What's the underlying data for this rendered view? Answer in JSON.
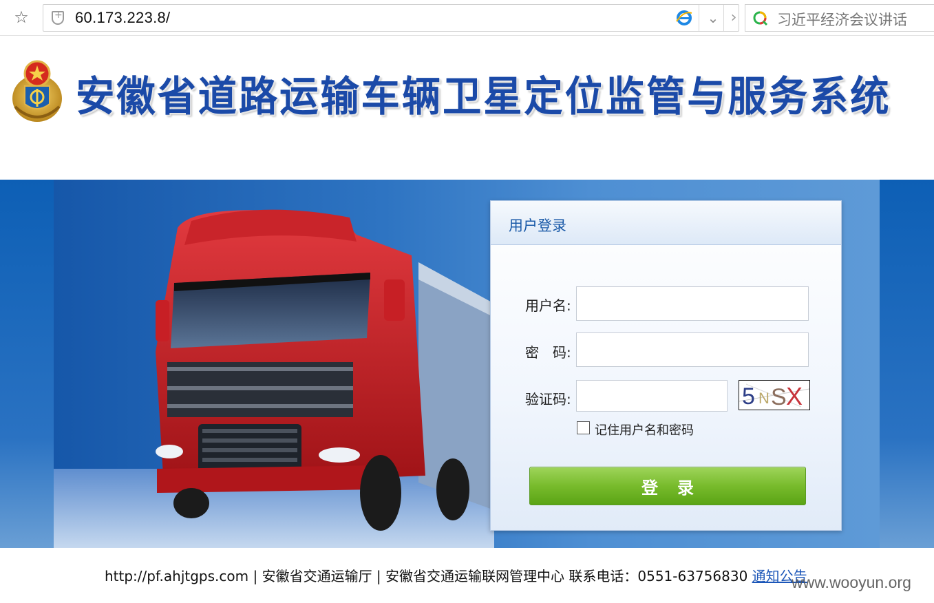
{
  "browser": {
    "url": "60.173.223.8/",
    "search_placeholder": "习近平经济会议讲话"
  },
  "header": {
    "site_title": "安徽省道路运输车辆卫星定位监管与服务系统"
  },
  "login": {
    "title": "用户登录",
    "username_label": "用户名:",
    "username_value": "",
    "password_label": "密　码:",
    "password_value": "",
    "captcha_label": "验证码:",
    "captcha_value": "",
    "captcha_image_text": "5NSX",
    "remember_label": "记住用户名和密码",
    "remember_checked": false,
    "submit_label": "登录"
  },
  "footer": {
    "text": "http://pf.ahjtgps.com | 安徽省交通运输厅 | 安徽省交通运输联网管理中心 联系电话：0551-63756830 ",
    "notice_link": "通知公告"
  },
  "watermark": "www.wooyun.org",
  "colors": {
    "title_blue": "#1b4aa8",
    "banner_blue": "#1f6cc0",
    "login_button_green": "#78bb2c",
    "link_blue": "#1b56b8"
  }
}
